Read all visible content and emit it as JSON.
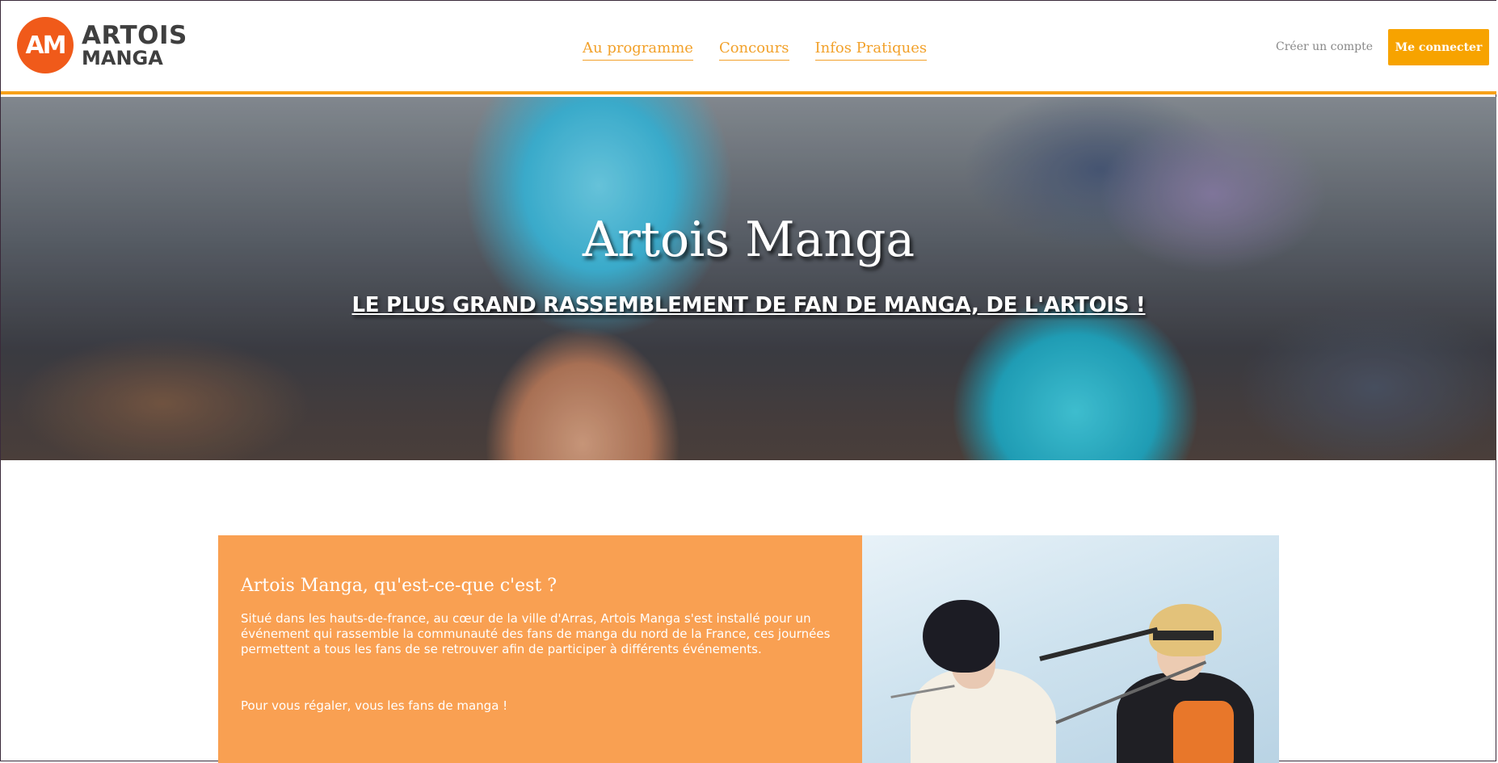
{
  "header": {
    "logo": {
      "monogram": "AM",
      "line1": "ARTOIS",
      "line2": "MANGA"
    },
    "nav": [
      {
        "label": "Au programme"
      },
      {
        "label": "Concours"
      },
      {
        "label": "Infos Pratiques"
      }
    ],
    "create_account": "Créer un compte",
    "login_button": "Me connecter"
  },
  "hero": {
    "title": "Artois Manga",
    "subtitle": "LE PLUS GRAND RASSEMBLEMENT DE FAN DE MANGA, DE L'ARTOIS !"
  },
  "about": {
    "title": "Artois Manga, qu'est-ce-que c'est ?",
    "paragraph1": "Situé dans les hauts-de-france, au cœur de la ville d'Arras, Artois Manga s'est installé pour un événement qui rassemble la communauté des fans de manga du nord de la France, ces journées permettent a tous les fans de se retrouver afin de participer à différents événements.",
    "paragraph2": "Pour vous régaler, vous les fans de manga !"
  },
  "colors": {
    "accent": "#f7a300",
    "nav_link": "#f2a12a",
    "logo_orange": "#f05a1a",
    "about_bg": "#f9a052"
  }
}
